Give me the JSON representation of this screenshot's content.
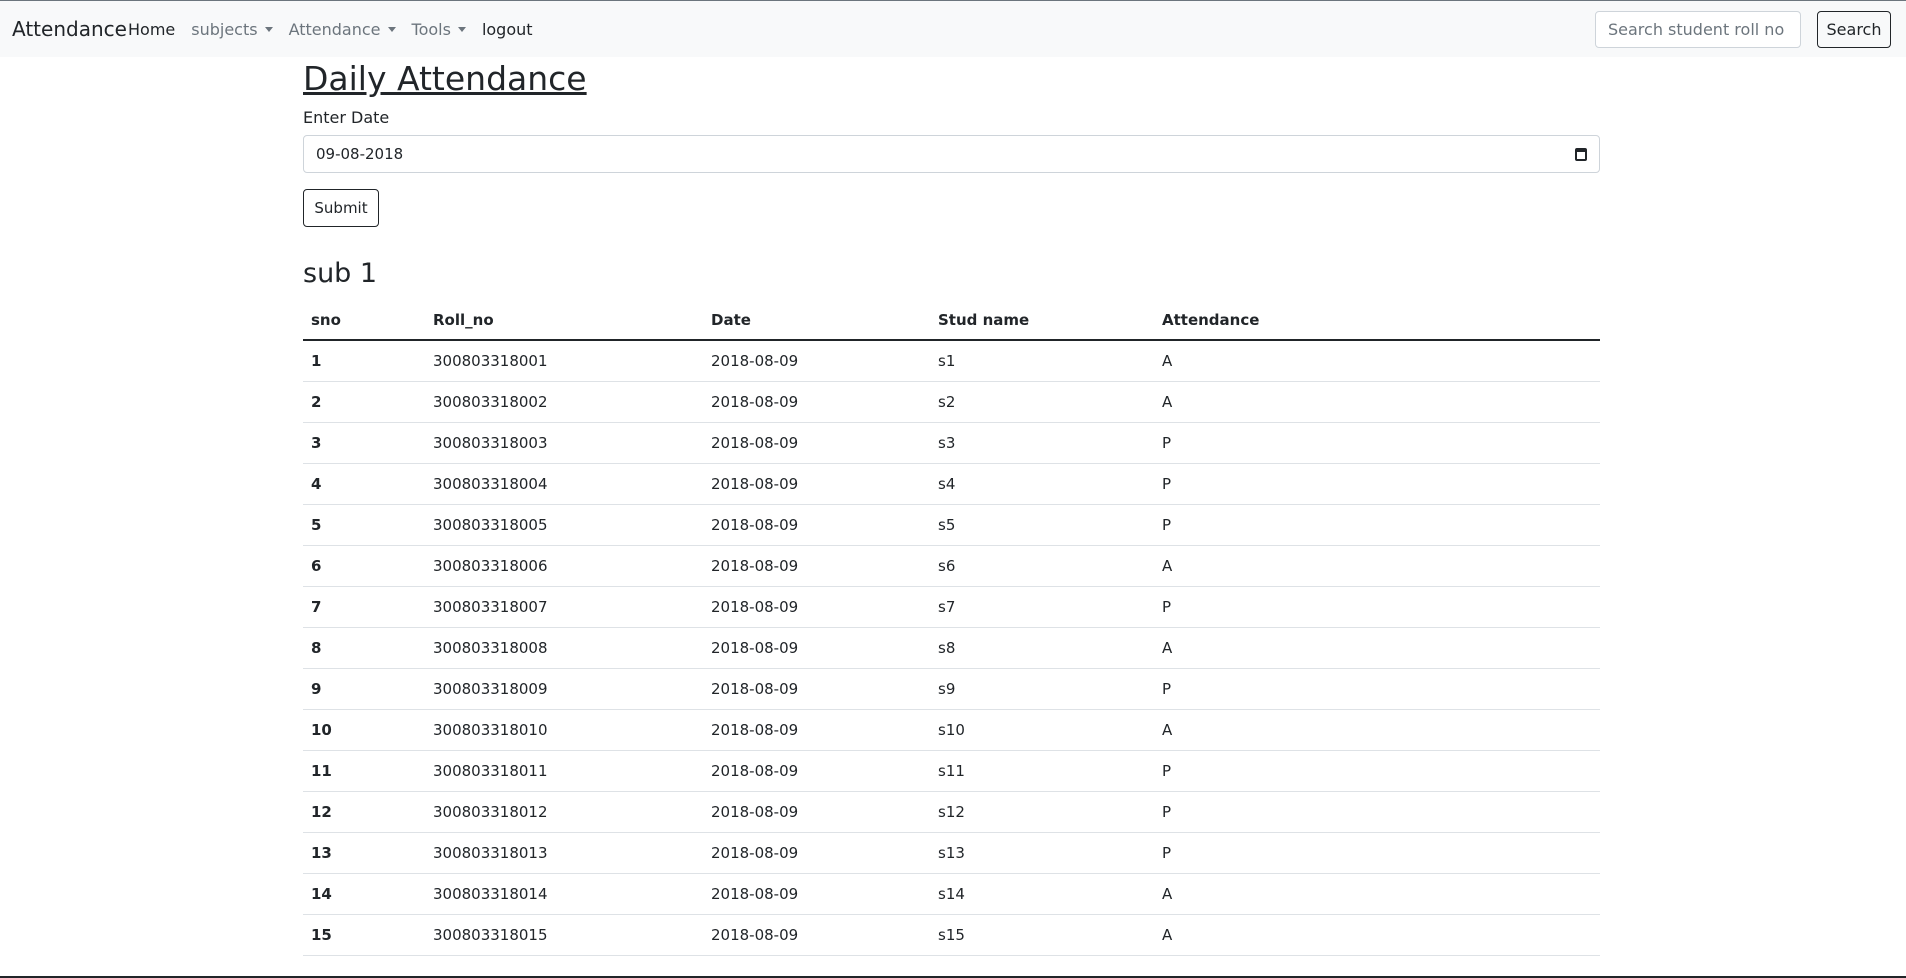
{
  "nav": {
    "brand": "Attendance",
    "links": [
      {
        "label": "Home",
        "dropdown": false
      },
      {
        "label": "subjects",
        "dropdown": true
      },
      {
        "label": "Attendance",
        "dropdown": true
      },
      {
        "label": "Tools",
        "dropdown": true
      },
      {
        "label": "logout",
        "dropdown": false
      }
    ],
    "search_placeholder": "Search student roll no",
    "search_button": "Search"
  },
  "page": {
    "title": "Daily Attendance",
    "date_label": "Enter Date",
    "date_value": "09-08-2018",
    "submit_label": "Submit",
    "section_title": "sub 1"
  },
  "table": {
    "columns": [
      "sno",
      "Roll_no",
      "Date",
      "Stud name",
      "Attendance"
    ],
    "rows": [
      [
        "1",
        "300803318001",
        "2018-08-09",
        "s1",
        "A"
      ],
      [
        "2",
        "300803318002",
        "2018-08-09",
        "s2",
        "A"
      ],
      [
        "3",
        "300803318003",
        "2018-08-09",
        "s3",
        "P"
      ],
      [
        "4",
        "300803318004",
        "2018-08-09",
        "s4",
        "P"
      ],
      [
        "5",
        "300803318005",
        "2018-08-09",
        "s5",
        "P"
      ],
      [
        "6",
        "300803318006",
        "2018-08-09",
        "s6",
        "A"
      ],
      [
        "7",
        "300803318007",
        "2018-08-09",
        "s7",
        "P"
      ],
      [
        "8",
        "300803318008",
        "2018-08-09",
        "s8",
        "A"
      ],
      [
        "9",
        "300803318009",
        "2018-08-09",
        "s9",
        "P"
      ],
      [
        "10",
        "300803318010",
        "2018-08-09",
        "s10",
        "A"
      ],
      [
        "11",
        "300803318011",
        "2018-08-09",
        "s11",
        "P"
      ],
      [
        "12",
        "300803318012",
        "2018-08-09",
        "s12",
        "P"
      ],
      [
        "13",
        "300803318013",
        "2018-08-09",
        "s13",
        "P"
      ],
      [
        "14",
        "300803318014",
        "2018-08-09",
        "s14",
        "A"
      ],
      [
        "15",
        "300803318015",
        "2018-08-09",
        "s15",
        "A"
      ]
    ]
  }
}
